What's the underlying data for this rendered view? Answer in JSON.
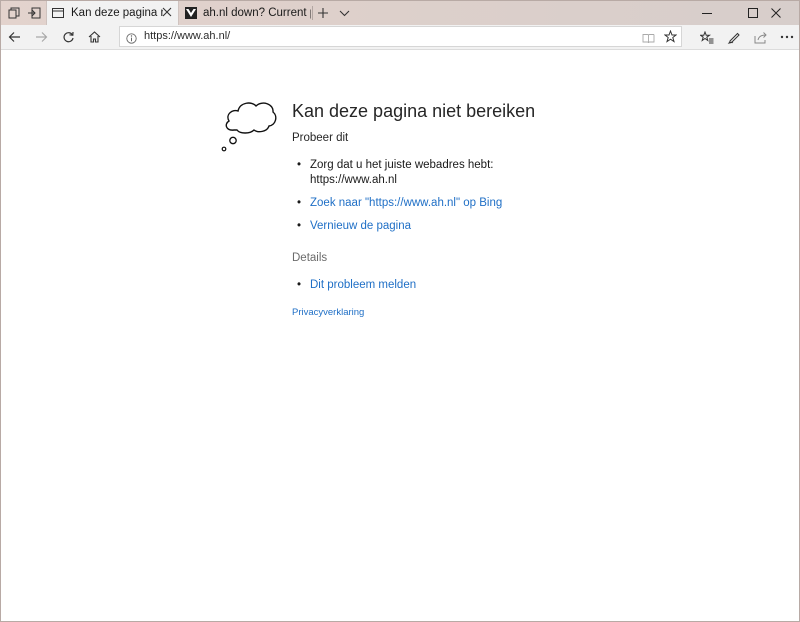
{
  "tabs": [
    {
      "title": "Kan deze pagina niet be",
      "active": true
    },
    {
      "title": "ah.nl down? Current proble",
      "active": false
    }
  ],
  "address": {
    "url": "https://www.ah.nl/"
  },
  "error": {
    "title": "Kan deze pagina niet bereiken",
    "subtitle": "Probeer dit",
    "suggestion_line1": "Zorg dat u het juiste webadres hebt:",
    "suggestion_line2": "https://www.ah.nl",
    "search_link": "Zoek naar \"https://www.ah.nl\" op Bing",
    "refresh_link": "Vernieuw de pagina",
    "details_label": "Details",
    "report_link": "Dit probleem melden",
    "privacy_link": "Privacyverklaring"
  },
  "icons": {
    "tab_actions": "tab-actions-icon",
    "set_aside": "set-aside-tabs-icon",
    "page": "page-icon",
    "favicon": "downdetector-favicon",
    "close": "close-icon",
    "new_tab": "plus-icon",
    "tab_preview": "chevron-down-icon",
    "minimize": "minimize-icon",
    "maximize": "maximize-icon",
    "window_close": "window-close-icon",
    "back": "back-arrow-icon",
    "forward": "forward-arrow-icon",
    "refresh": "refresh-icon",
    "home": "home-icon",
    "info": "info-icon",
    "reading_view": "reading-view-icon",
    "favorite": "star-icon",
    "favorites_hub": "favorites-hub-icon",
    "notes": "pen-icon",
    "share": "share-icon",
    "more": "more-icon"
  },
  "colors": {
    "link": "#1f6fc6",
    "titlebar": "#e3d3cd",
    "toolbar": "#f2f2f2"
  }
}
